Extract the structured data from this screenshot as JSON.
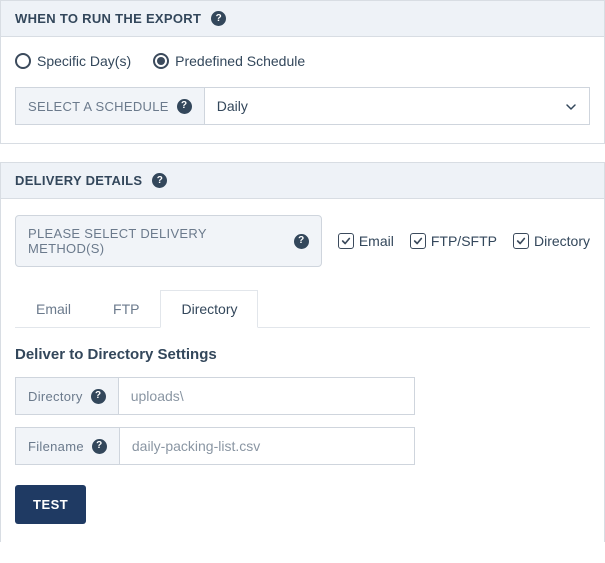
{
  "when_to_run": {
    "title": "WHEN TO RUN THE EXPORT",
    "radio_specific": "Specific Day(s)",
    "radio_predefined": "Predefined Schedule",
    "schedule_label": "SELECT A SCHEDULE",
    "schedule_value": "Daily"
  },
  "delivery": {
    "title": "DELIVERY DETAILS",
    "method_label": "PLEASE SELECT DELIVERY METHOD(S)",
    "option_email": "Email",
    "option_ftp": "FTP/SFTP",
    "option_directory": "Directory",
    "tabs": {
      "email": "Email",
      "ftp": "FTP",
      "directory": "Directory"
    },
    "settings_title": "Deliver to Directory Settings",
    "directory_label": "Directory",
    "directory_value": "uploads\\",
    "filename_label": "Filename",
    "filename_value": "daily-packing-list.csv",
    "test_button": "TEST"
  }
}
